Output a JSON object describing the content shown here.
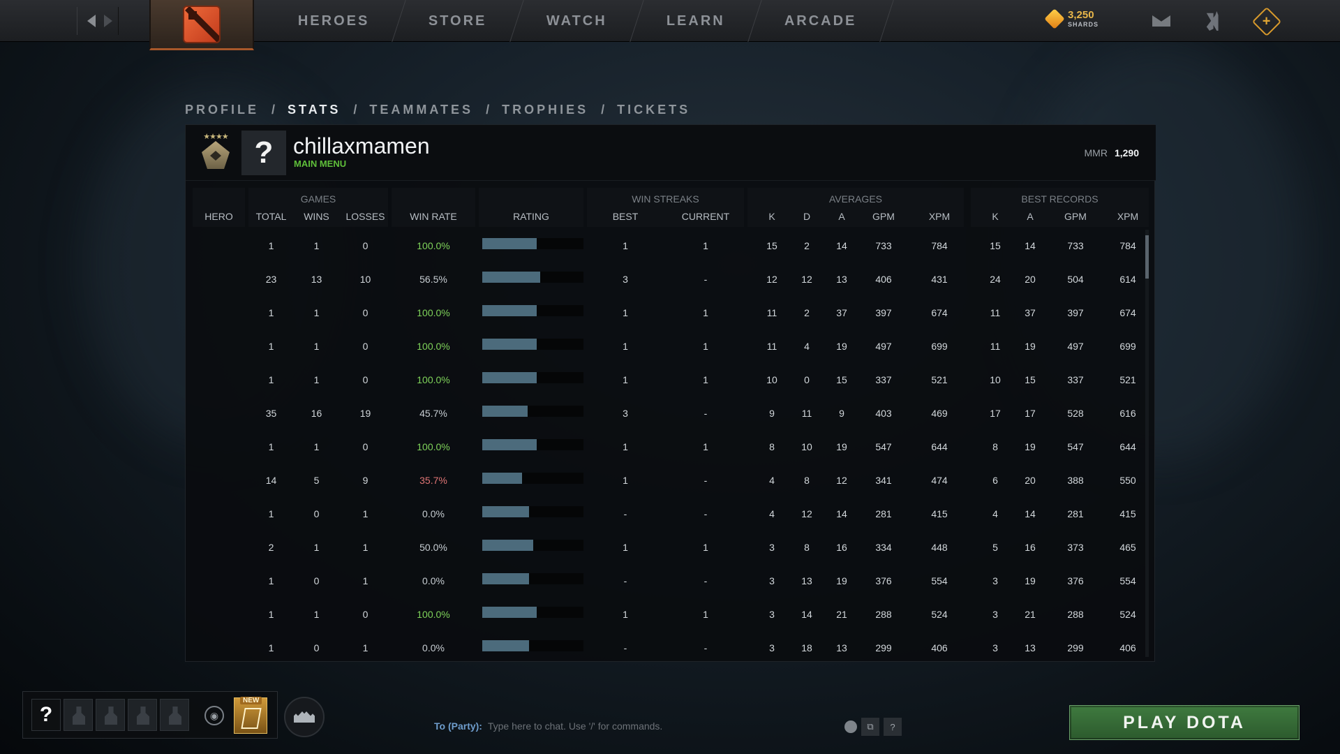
{
  "topbar": {
    "nav": [
      "HEROES",
      "STORE",
      "WATCH",
      "LEARN",
      "ARCADE"
    ],
    "shards_value": "3,250",
    "shards_label": "SHARDS"
  },
  "subnav": {
    "items": [
      "PROFILE",
      "STATS",
      "TEAMMATES",
      "TROPHIES",
      "TICKETS"
    ],
    "active": "STATS"
  },
  "profile": {
    "avatar_glyph": "?",
    "username": "chillaxmamen",
    "status": "MAIN MENU",
    "mmr_label": "MMR",
    "mmr_value": "1,290"
  },
  "table": {
    "groups": {
      "games": "GAMES",
      "win_streaks": "WIN STREAKS",
      "averages": "AVERAGES",
      "best_records": "BEST RECORDS"
    },
    "headers": {
      "hero": "HERO",
      "total": "TOTAL",
      "wins": "WINS",
      "losses": "LOSSES",
      "win_rate": "WIN RATE",
      "rating": "RATING",
      "best": "BEST",
      "current": "CURRENT",
      "avg_k": "K",
      "avg_d": "D",
      "avg_a": "A",
      "avg_gpm": "GPM",
      "avg_xpm": "XPM",
      "best_k": "K",
      "best_a": "A",
      "best_gpm": "GPM",
      "best_xpm": "XPM"
    },
    "rows": [
      {
        "total": "1",
        "wins": "1",
        "losses": "0",
        "win_rate": "100.0%",
        "rating": 0.54,
        "best": "1",
        "current": "1",
        "k": "15",
        "d": "2",
        "a": "14",
        "gpm": "733",
        "xpm": "784",
        "bk": "15",
        "ba": "14",
        "bgpm": "733",
        "bxpm": "784"
      },
      {
        "total": "23",
        "wins": "13",
        "losses": "10",
        "win_rate": "56.5%",
        "rating": 0.57,
        "best": "3",
        "current": "-",
        "k": "12",
        "d": "12",
        "a": "13",
        "gpm": "406",
        "xpm": "431",
        "bk": "24",
        "ba": "20",
        "bgpm": "504",
        "bxpm": "614"
      },
      {
        "total": "1",
        "wins": "1",
        "losses": "0",
        "win_rate": "100.0%",
        "rating": 0.54,
        "best": "1",
        "current": "1",
        "k": "11",
        "d": "2",
        "a": "37",
        "gpm": "397",
        "xpm": "674",
        "bk": "11",
        "ba": "37",
        "bgpm": "397",
        "bxpm": "674"
      },
      {
        "total": "1",
        "wins": "1",
        "losses": "0",
        "win_rate": "100.0%",
        "rating": 0.54,
        "best": "1",
        "current": "1",
        "k": "11",
        "d": "4",
        "a": "19",
        "gpm": "497",
        "xpm": "699",
        "bk": "11",
        "ba": "19",
        "bgpm": "497",
        "bxpm": "699"
      },
      {
        "total": "1",
        "wins": "1",
        "losses": "0",
        "win_rate": "100.0%",
        "rating": 0.54,
        "best": "1",
        "current": "1",
        "k": "10",
        "d": "0",
        "a": "15",
        "gpm": "337",
        "xpm": "521",
        "bk": "10",
        "ba": "15",
        "bgpm": "337",
        "bxpm": "521"
      },
      {
        "total": "35",
        "wins": "16",
        "losses": "19",
        "win_rate": "45.7%",
        "rating": 0.45,
        "best": "3",
        "current": "-",
        "k": "9",
        "d": "11",
        "a": "9",
        "gpm": "403",
        "xpm": "469",
        "bk": "17",
        "ba": "17",
        "bgpm": "528",
        "bxpm": "616"
      },
      {
        "total": "1",
        "wins": "1",
        "losses": "0",
        "win_rate": "100.0%",
        "rating": 0.54,
        "best": "1",
        "current": "1",
        "k": "8",
        "d": "10",
        "a": "19",
        "gpm": "547",
        "xpm": "644",
        "bk": "8",
        "ba": "19",
        "bgpm": "547",
        "bxpm": "644"
      },
      {
        "total": "14",
        "wins": "5",
        "losses": "9",
        "win_rate": "35.7%",
        "rating": 0.39,
        "best": "1",
        "current": "-",
        "k": "4",
        "d": "8",
        "a": "12",
        "gpm": "341",
        "xpm": "474",
        "bk": "6",
        "ba": "20",
        "bgpm": "388",
        "bxpm": "550"
      },
      {
        "total": "1",
        "wins": "0",
        "losses": "1",
        "win_rate": "0.0%",
        "rating": 0.46,
        "best": "-",
        "current": "-",
        "k": "4",
        "d": "12",
        "a": "14",
        "gpm": "281",
        "xpm": "415",
        "bk": "4",
        "ba": "14",
        "bgpm": "281",
        "bxpm": "415"
      },
      {
        "total": "2",
        "wins": "1",
        "losses": "1",
        "win_rate": "50.0%",
        "rating": 0.5,
        "best": "1",
        "current": "1",
        "k": "3",
        "d": "8",
        "a": "16",
        "gpm": "334",
        "xpm": "448",
        "bk": "5",
        "ba": "16",
        "bgpm": "373",
        "bxpm": "465"
      },
      {
        "total": "1",
        "wins": "0",
        "losses": "1",
        "win_rate": "0.0%",
        "rating": 0.46,
        "best": "-",
        "current": "-",
        "k": "3",
        "d": "13",
        "a": "19",
        "gpm": "376",
        "xpm": "554",
        "bk": "3",
        "ba": "19",
        "bgpm": "376",
        "bxpm": "554"
      },
      {
        "total": "1",
        "wins": "1",
        "losses": "0",
        "win_rate": "100.0%",
        "rating": 0.54,
        "best": "1",
        "current": "1",
        "k": "3",
        "d": "14",
        "a": "21",
        "gpm": "288",
        "xpm": "524",
        "bk": "3",
        "ba": "21",
        "bgpm": "288",
        "bxpm": "524"
      },
      {
        "total": "1",
        "wins": "0",
        "losses": "1",
        "win_rate": "0.0%",
        "rating": 0.46,
        "best": "-",
        "current": "-",
        "k": "3",
        "d": "18",
        "a": "13",
        "gpm": "299",
        "xpm": "406",
        "bk": "3",
        "ba": "13",
        "bgpm": "299",
        "bxpm": "406"
      }
    ]
  },
  "bottom": {
    "party_self_glyph": "?",
    "new_badge": "NEW",
    "chat_target": "To (Party):",
    "chat_placeholder": "Type here to chat. Use '/' for commands.",
    "help_glyph": "?",
    "play_button": "PLAY DOTA"
  },
  "colors": {
    "accent_green": "#5fbf3a",
    "win_good": "#7fd35a",
    "win_bad": "#e07575",
    "rating_bar": "#4c6b7c",
    "shards_gold": "#e8b64a",
    "play_green": "#3f7a3f"
  },
  "icons": [
    "back-arrow-icon",
    "forward-arrow-icon",
    "dota-logo-icon",
    "shards-icon",
    "mail-icon",
    "armory-icon",
    "dota-plus-icon",
    "rank-medal-icon",
    "voice-icon",
    "battle-pass-icon",
    "find-group-icon",
    "emoji-icon",
    "screenshot-icon",
    "help-icon"
  ]
}
